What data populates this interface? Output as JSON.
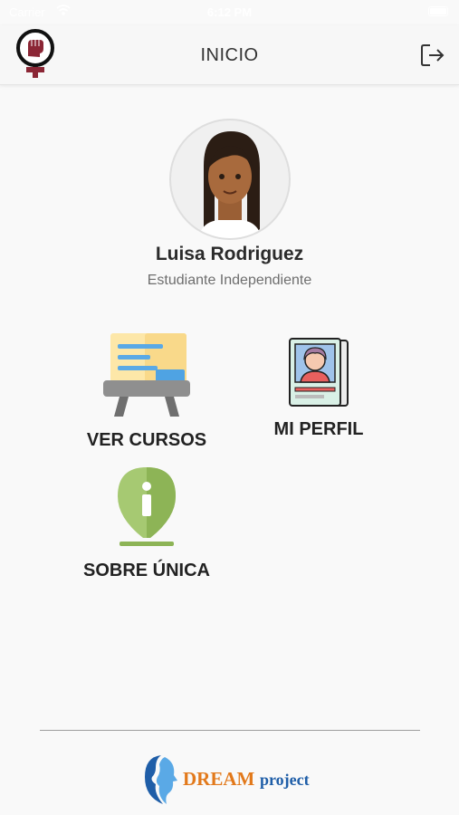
{
  "status_bar": {
    "carrier": "Carrier",
    "time": "6:12 PM"
  },
  "header": {
    "title": "INICIO"
  },
  "profile": {
    "name": "Luisa Rodriguez",
    "role": "Estudiante Independiente"
  },
  "menu": {
    "courses_label": "VER CURSOS",
    "profile_label": "MI PERFIL",
    "about_label": "SOBRE ÚNICA"
  },
  "footer": {
    "brand_primary": "DREAM",
    "brand_secondary": "project"
  },
  "colors": {
    "background": "#f9f9f9",
    "header": "#f7f7f7",
    "brand_logo": "#8b2635",
    "dream_orange": "#e2791b",
    "dream_blue": "#1f5ea8"
  }
}
